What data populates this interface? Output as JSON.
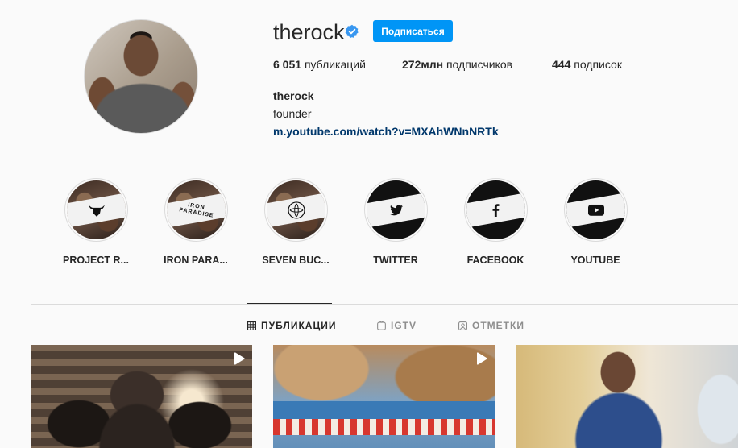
{
  "profile": {
    "username": "therock",
    "follow_label": "Подписаться",
    "stats": {
      "posts_count": "6 051",
      "posts_label": "публикаций",
      "followers_count": "272млн",
      "followers_label": "подписчиков",
      "following_count": "444",
      "following_label": "подписок"
    },
    "full_name": "therock",
    "bio": "founder",
    "link": "m.youtube.com/watch?v=MXAhWNnNRTk"
  },
  "highlights": [
    {
      "label": "PROJECT R...",
      "icon": "bull-icon"
    },
    {
      "label": "IRON PARA...",
      "icon": "iron-paradise-logo"
    },
    {
      "label": "SEVEN BUC...",
      "icon": "seven-bucks-logo"
    },
    {
      "label": "TWITTER",
      "icon": "twitter-icon"
    },
    {
      "label": "FACEBOOK",
      "icon": "facebook-icon"
    },
    {
      "label": "YOUTUBE",
      "icon": "youtube-icon"
    }
  ],
  "iron_paradise_text": {
    "line1": "IRON",
    "line2": "PARADISE"
  },
  "tabs": [
    {
      "label": "ПУБЛИКАЦИИ",
      "icon": "grid-icon",
      "active": true
    },
    {
      "label": "IGTV",
      "icon": "igtv-icon",
      "active": false
    },
    {
      "label": "ОТМЕТКИ",
      "icon": "tagged-icon",
      "active": false
    }
  ],
  "posts": [
    {
      "type": "video",
      "icon": "play-icon"
    },
    {
      "type": "video",
      "icon": "play-icon"
    },
    {
      "type": "image"
    }
  ],
  "colors": {
    "accent": "#0095f6",
    "link": "#00376b",
    "verified": "#3897f0",
    "background": "#fafafa"
  }
}
